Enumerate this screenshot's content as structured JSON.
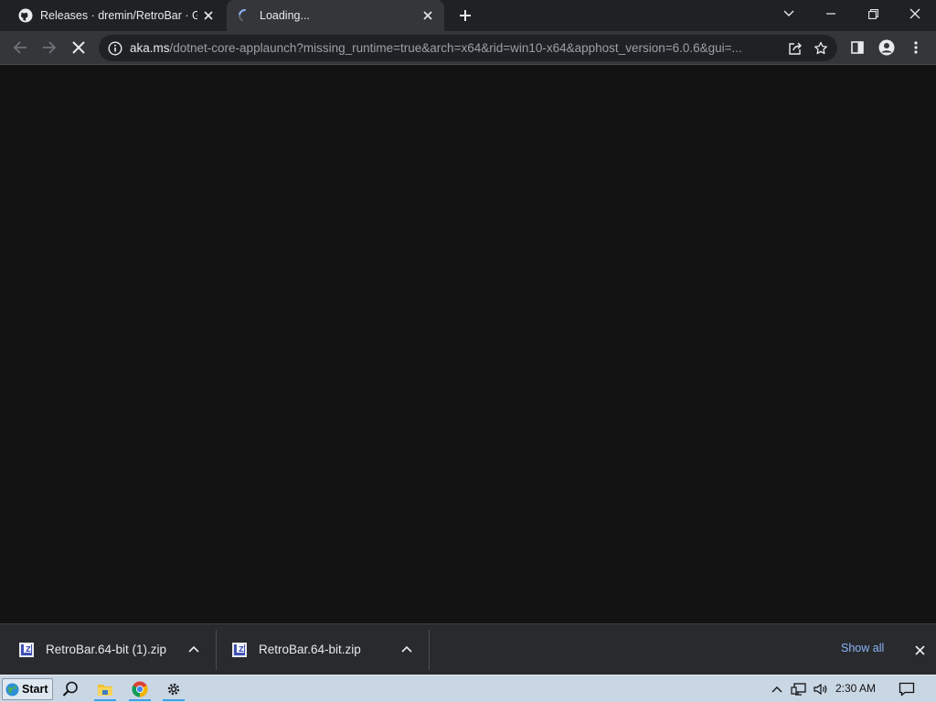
{
  "tabs": [
    {
      "title": "Releases · dremin/RetroBar · GitHub",
      "favicon": "github-icon",
      "active": false
    },
    {
      "title": "Loading...",
      "favicon": "loading-spinner-icon",
      "active": true
    }
  ],
  "toolbar": {
    "url_host": "aka.ms",
    "url_rest": "/dotnet-core-applaunch?missing_runtime=true&arch=x64&rid=win10-x64&apphost_version=6.0.6&gui=..."
  },
  "downloads": [
    {
      "name": "RetroBar.64-bit (1).zip",
      "icon": "zip-archive-icon"
    },
    {
      "name": "RetroBar.64-bit.zip",
      "icon": "zip-archive-icon"
    }
  ],
  "shelf": {
    "show_all_label": "Show all"
  },
  "taskbar": {
    "start_label": "Start",
    "pinned": [
      "search-icon",
      "file-explorer-icon",
      "chrome-icon",
      "settings-icon"
    ],
    "clock": "2:30 AM"
  },
  "colors": {
    "accent": "#8ab4f8",
    "taskbar": "#c9d6e4",
    "page": "#131313"
  }
}
